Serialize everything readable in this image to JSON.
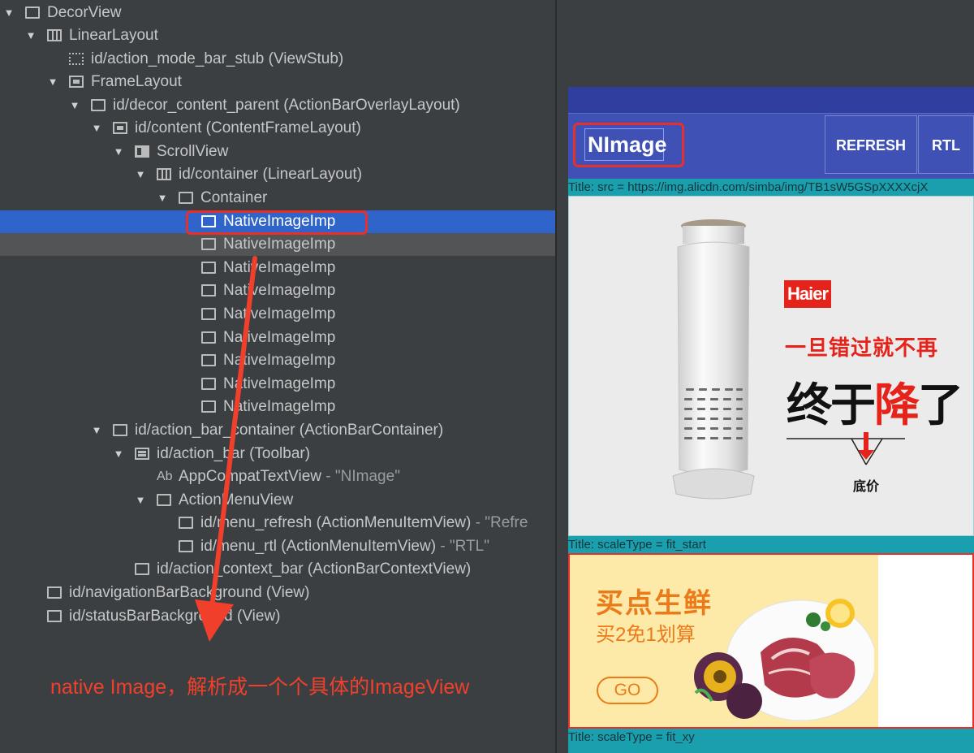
{
  "tree": {
    "rows": [
      {
        "label": "DecorView",
        "extra": ""
      },
      {
        "label": "LinearLayout",
        "extra": ""
      },
      {
        "label": "id/action_mode_bar_stub (ViewStub)",
        "extra": ""
      },
      {
        "label": "FrameLayout",
        "extra": ""
      },
      {
        "label": "id/decor_content_parent (ActionBarOverlayLayout)",
        "extra": ""
      },
      {
        "label": "id/content (ContentFrameLayout)",
        "extra": ""
      },
      {
        "label": "ScrollView",
        "extra": ""
      },
      {
        "label": "id/container (LinearLayout)",
        "extra": ""
      },
      {
        "label": "Container",
        "extra": ""
      },
      {
        "label": "NativeImageImp",
        "extra": ""
      },
      {
        "label": "NativeImageImp",
        "extra": ""
      },
      {
        "label": "NativeImageImp",
        "extra": ""
      },
      {
        "label": "NativeImageImp",
        "extra": ""
      },
      {
        "label": "NativeImageImp",
        "extra": ""
      },
      {
        "label": "NativeImageImp",
        "extra": ""
      },
      {
        "label": "NativeImageImp",
        "extra": ""
      },
      {
        "label": "NativeImageImp",
        "extra": ""
      },
      {
        "label": "NativeImageImp",
        "extra": ""
      },
      {
        "label": "id/action_bar_container (ActionBarContainer)",
        "extra": ""
      },
      {
        "label": "id/action_bar (Toolbar)",
        "extra": ""
      },
      {
        "label": "AppCompatTextView",
        "extra": " - \"NImage\""
      },
      {
        "label": "ActionMenuView",
        "extra": ""
      },
      {
        "label": "id/menu_refresh (ActionMenuItemView)",
        "extra": " - \"Refre"
      },
      {
        "label": "id/menu_rtl (ActionMenuItemView)",
        "extra": " - \"RTL\""
      },
      {
        "label": "id/action_context_bar (ActionBarContextView)",
        "extra": ""
      },
      {
        "label": "id/navigationBarBackground (View)",
        "extra": ""
      },
      {
        "label": "id/statusBarBackground (View)",
        "extra": ""
      }
    ]
  },
  "icons": {
    "expand_arrow": "▼",
    "text_view": "Ab"
  },
  "annotation": "native Image，解析成一个个具体的ImageView",
  "preview": {
    "app_title": "NImage",
    "menu_refresh": "REFRESH",
    "menu_rtl": "RTL",
    "caption1": "Title: src = https://img.alicdn.com/simba/img/TB1sW5GSpXXXXcjX",
    "caption2": "Title: scaleType = fit_start",
    "caption3": "Title: scaleType = fit_xy",
    "haier": {
      "logo": "Haier",
      "slogan1": "一旦错过就不再",
      "slogan2_a": "终于",
      "slogan2_b": "降",
      "slogan2_c": "了",
      "lowest": "底价"
    },
    "banner": {
      "title": "买点生鲜",
      "subtitle": "买2免1划算",
      "go": "GO"
    }
  },
  "colors": {
    "selection": "#2f65ca",
    "highlight_outline": "#e8302a",
    "app_bar": "#3f51b5",
    "status_bar": "#303f9f",
    "caption_bg": "#1a9fae",
    "annotation": "#f0402c"
  }
}
